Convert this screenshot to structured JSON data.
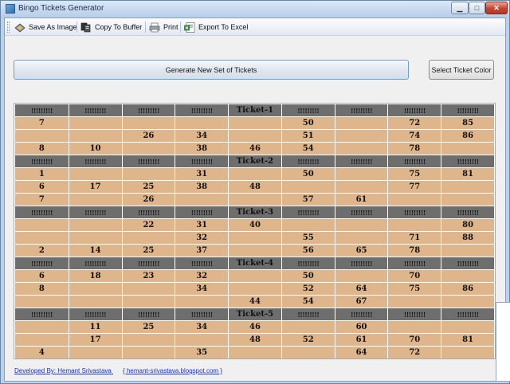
{
  "window": {
    "title": "Bingo Tickets Generator",
    "min_glyph": "▁",
    "max_glyph": "□",
    "close_glyph": "✕"
  },
  "toolbar": {
    "save_image": "Save As Image",
    "copy_buffer": "Copy To Buffer",
    "print": "Print",
    "export_excel": "Export To Excel",
    "icons": [
      "image-icon",
      "copy-icon",
      "printer-icon",
      "excel-icon"
    ]
  },
  "buttons": {
    "generate": "Generate New Set of Tickets",
    "select_color": "Select Ticket Color"
  },
  "tickets": [
    {
      "header": [
        "!!!!!!!!!",
        "!!!!!!!!!",
        "!!!!!!!!!",
        "!!!!!!!!!",
        "Ticket-1",
        "!!!!!!!!!",
        "!!!!!!!!!",
        "!!!!!!!!!",
        "!!!!!!!!!"
      ],
      "rows": [
        [
          "7",
          "",
          "",
          "",
          "",
          "50",
          "",
          "72",
          "85"
        ],
        [
          "",
          "",
          "26",
          "34",
          "",
          "51",
          "",
          "74",
          "86"
        ],
        [
          "8",
          "10",
          "",
          "38",
          "46",
          "54",
          "",
          "78",
          ""
        ]
      ]
    },
    {
      "header": [
        "!!!!!!!!!",
        "!!!!!!!!!",
        "!!!!!!!!!",
        "!!!!!!!!!",
        "Ticket-2",
        "!!!!!!!!!",
        "!!!!!!!!!",
        "!!!!!!!!!",
        "!!!!!!!!!"
      ],
      "rows": [
        [
          "1",
          "",
          "",
          "31",
          "",
          "50",
          "",
          "75",
          "81"
        ],
        [
          "6",
          "17",
          "25",
          "38",
          "48",
          "",
          "",
          "77",
          ""
        ],
        [
          "7",
          "",
          "26",
          "",
          "",
          "57",
          "61",
          "",
          ""
        ]
      ]
    },
    {
      "header": [
        "!!!!!!!!!",
        "!!!!!!!!!",
        "!!!!!!!!!",
        "!!!!!!!!!",
        "Ticket-3",
        "!!!!!!!!!",
        "!!!!!!!!!",
        "!!!!!!!!!",
        "!!!!!!!!!"
      ],
      "rows": [
        [
          "",
          "",
          "22",
          "31",
          "40",
          "",
          "",
          "",
          "80"
        ],
        [
          "",
          "",
          "",
          "32",
          "",
          "55",
          "",
          "71",
          "88"
        ],
        [
          "2",
          "14",
          "25",
          "37",
          "",
          "56",
          "65",
          "78",
          ""
        ]
      ]
    },
    {
      "header": [
        "!!!!!!!!!",
        "!!!!!!!!!",
        "!!!!!!!!!",
        "!!!!!!!!!",
        "Ticket-4",
        "!!!!!!!!!",
        "!!!!!!!!!",
        "!!!!!!!!!",
        "!!!!!!!!!"
      ],
      "rows": [
        [
          "6",
          "18",
          "23",
          "32",
          "",
          "50",
          "",
          "70",
          ""
        ],
        [
          "8",
          "",
          "",
          "34",
          "",
          "52",
          "64",
          "75",
          "86"
        ],
        [
          "",
          "",
          "",
          "",
          "44",
          "54",
          "67",
          "",
          ""
        ]
      ]
    },
    {
      "header": [
        "!!!!!!!!!",
        "!!!!!!!!!",
        "!!!!!!!!!",
        "!!!!!!!!!",
        "Ticket-5",
        "!!!!!!!!!",
        "!!!!!!!!!",
        "!!!!!!!!!",
        "!!!!!!!!!"
      ],
      "rows": [
        [
          "",
          "11",
          "25",
          "34",
          "46",
          "",
          "60",
          "",
          ""
        ],
        [
          "",
          "17",
          "",
          "",
          "48",
          "52",
          "61",
          "70",
          "81"
        ],
        [
          "4",
          "",
          "",
          "35",
          "",
          "",
          "64",
          "72",
          ""
        ]
      ]
    }
  ],
  "footer": {
    "developer": "Developed By: Hemant Srivastava",
    "blog": "{ hemant-srivastava.blogspot.com }"
  },
  "colors": {
    "ticket_cell": "#dfb68b",
    "header_cell": "#6e6e6e",
    "link": "#1a33c8"
  }
}
